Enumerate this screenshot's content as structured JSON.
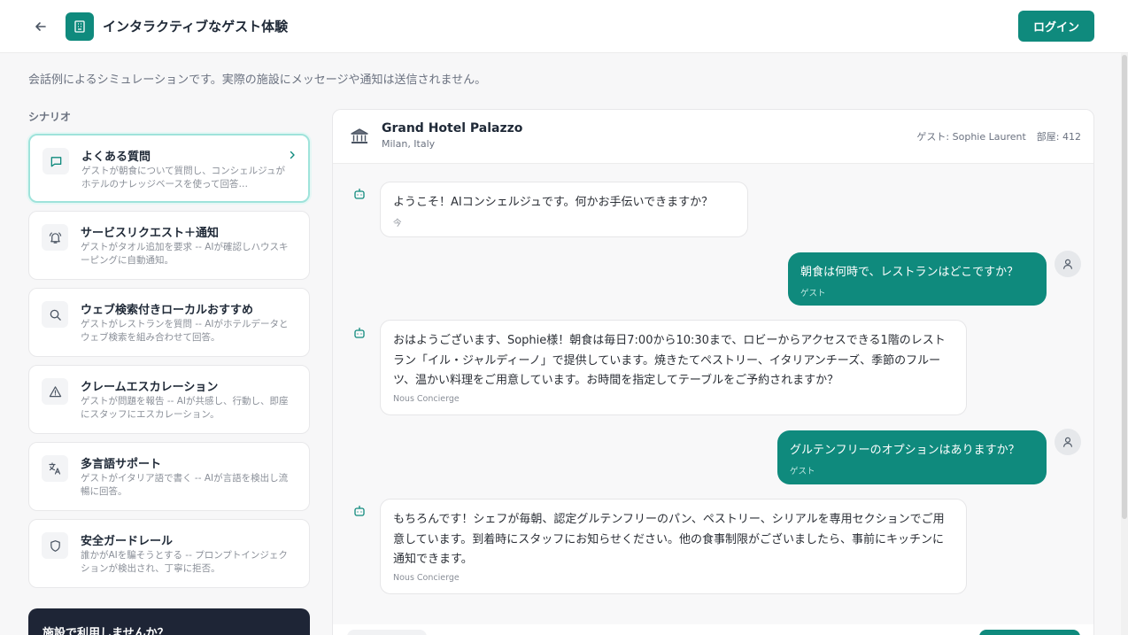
{
  "header": {
    "title": "インタラクティブなゲスト体験",
    "login_label": "ログイン"
  },
  "disclaimer": "会話例によるシミュレーションです。実際の施設にメッセージや通知は送信されません。",
  "scenarios": {
    "heading": "シナリオ",
    "items": [
      {
        "title": "よくある質問",
        "desc": "ゲストが朝食について質問し、コンシェルジュがホテルのナレッジベースを使って回答…",
        "icon": "message-square-icon"
      },
      {
        "title": "サービスリクエスト＋通知",
        "desc": "ゲストがタオル追加を要求 -- AIが確認しハウスキーピングに自動通知。",
        "icon": "bell-ring-icon"
      },
      {
        "title": "ウェブ検索付きローカルおすすめ",
        "desc": "ゲストがレストランを質問 -- AIがホテルデータとウェブ検索を組み合わせて回答。",
        "icon": "search-icon"
      },
      {
        "title": "クレームエスカレーション",
        "desc": "ゲストが問題を報告 -- AIが共感し、行動し、即座にスタッフにエスカレーション。",
        "icon": "alert-triangle-icon"
      },
      {
        "title": "多言語サポート",
        "desc": "ゲストがイタリア語で書く -- AIが言語を検出し流暢に回答。",
        "icon": "languages-icon"
      },
      {
        "title": "安全ガードレール",
        "desc": "誰かがAIを騙そうとする -- プロンプトインジェクションが検出され、丁寧に拒否。",
        "icon": "shield-icon"
      }
    ]
  },
  "promo": {
    "title": "施設で利用しませんか？"
  },
  "chat": {
    "hotel_name": "Grand Hotel Palazzo",
    "hotel_location": "Milan, Italy",
    "guest_label": "ゲスト: Sophie Laurent",
    "room_label": "部屋: 412",
    "messages": [
      {
        "role": "bot",
        "text": "ようこそ！AIコンシェルジュです。何かお手伝いできますか？",
        "meta": "今"
      },
      {
        "role": "user",
        "text": "朝食は何時で、レストランはどこですか？",
        "meta": "ゲスト"
      },
      {
        "role": "bot",
        "text": "おはようございます、Sophie様！朝食は毎日7:00から10:30まで、ロビーからアクセスできる1階のレストラン「イル・ジャルディーノ」で提供しています。焼きたてペストリー、イタリアンチーズ、季節のフルーツ、温かい料理をご用意しています。お時間を指定してテーブルをご予約されますか？",
        "meta": "Nous Concierge"
      },
      {
        "role": "user",
        "text": "グルテンフリーのオプションはありますか？",
        "meta": "ゲスト"
      },
      {
        "role": "bot",
        "text": "もちろんです！シェフが毎朝、認定グルテンフリーのパン、ペストリー、シリアルを専用セクションでご用意しています。到着時にスタッフにお知らせください。他の食事制限がございましたら、事前にキッチンに通知できます。",
        "meta": "Nous Concierge"
      }
    ]
  },
  "colors": {
    "brand": "#0f8a7d",
    "promo_bg": "#1e2536",
    "active_border": "#9fe3db"
  }
}
